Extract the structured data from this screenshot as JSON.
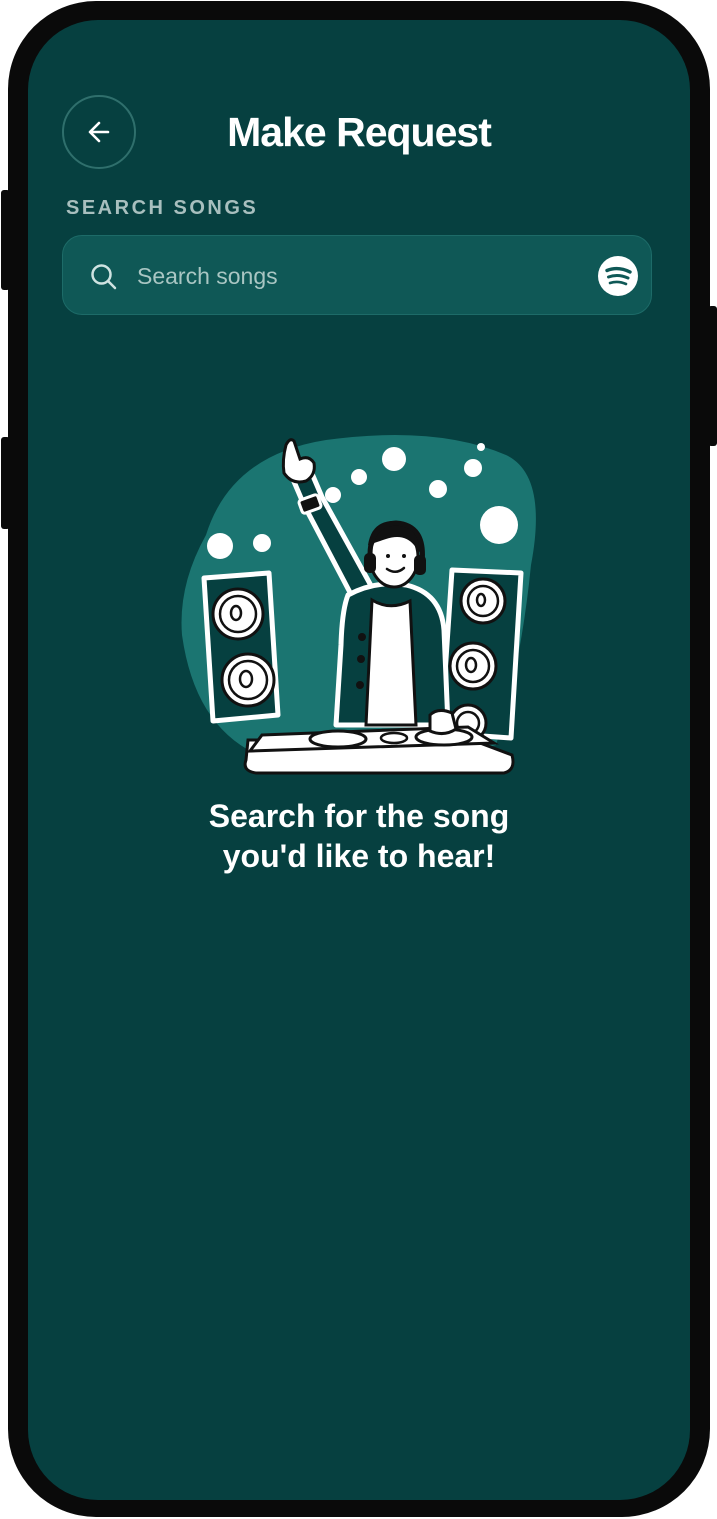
{
  "header": {
    "title": "Make Request",
    "back_icon": "arrow-left-icon"
  },
  "search": {
    "section_label": "SEARCH SONGS",
    "placeholder": "Search songs",
    "value": "",
    "icon": "search-icon",
    "provider_icon": "spotify-icon"
  },
  "empty_state": {
    "illustration": "dj-illustration",
    "message": "Search for the song\nyou'd like to hear!"
  },
  "colors": {
    "background": "#064040",
    "search_bg": "#0f5856",
    "accent": "#1b7571",
    "text": "#ffffff",
    "muted": "#a8bfbe"
  }
}
